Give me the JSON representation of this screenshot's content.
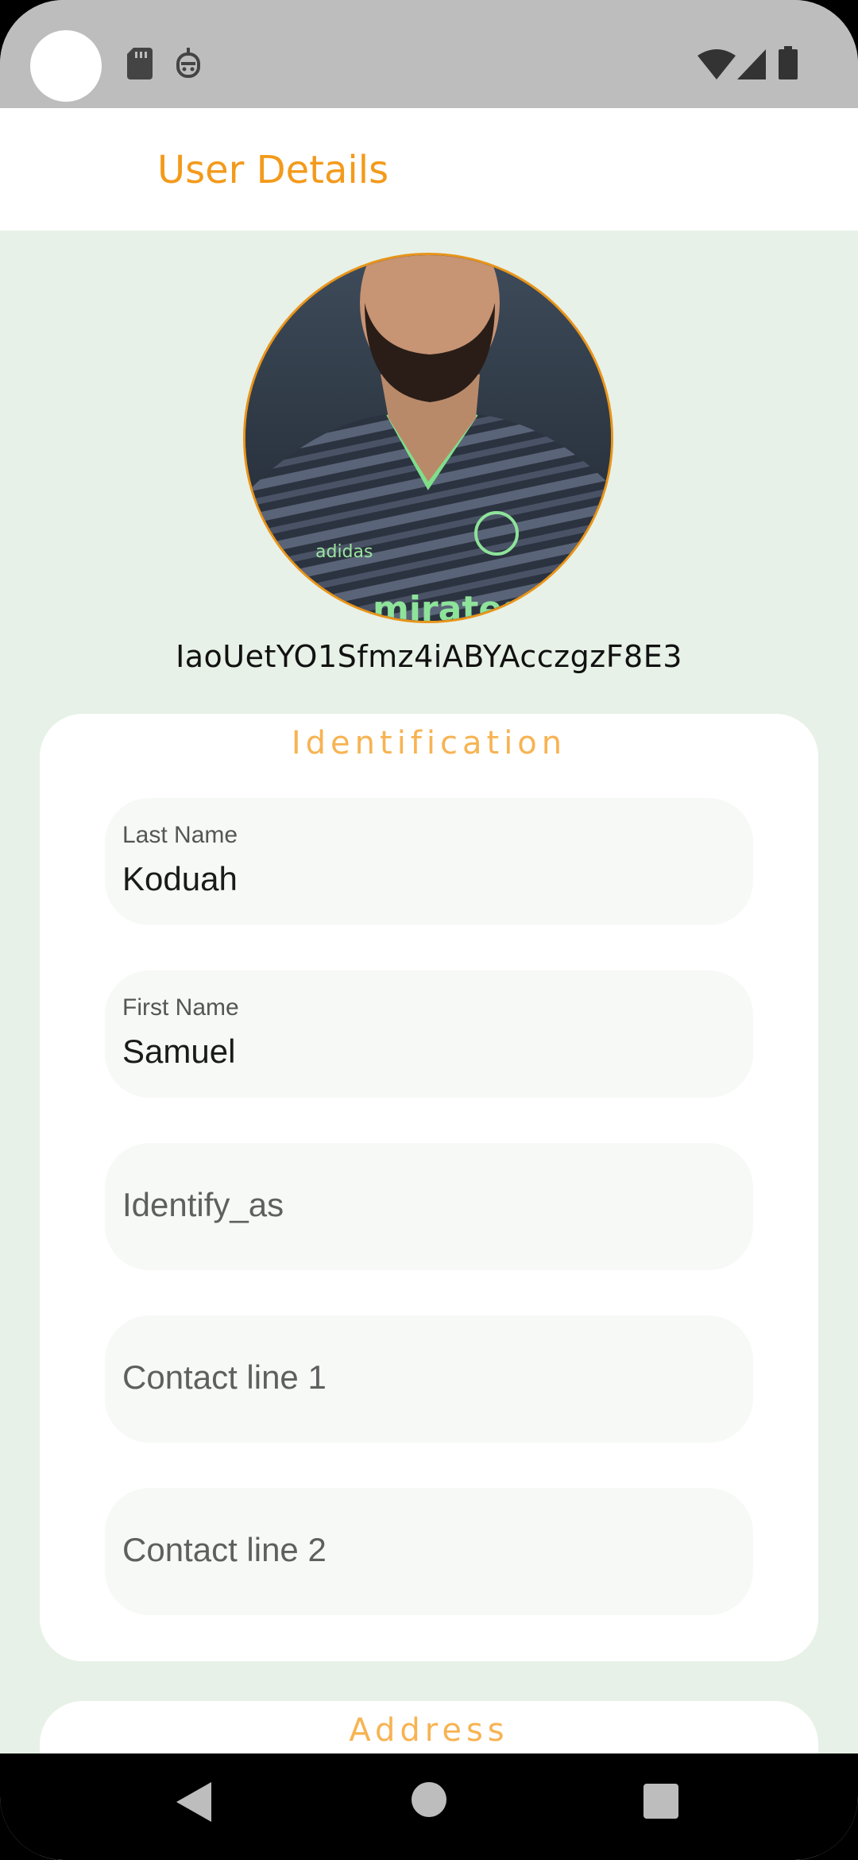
{
  "app_bar": {
    "title": "User Details"
  },
  "profile": {
    "user_id": "IaoUetYO1Sfmz4iABYAcczgzF8E3"
  },
  "identification": {
    "title": "Identification",
    "fields": [
      {
        "label": "Last Name",
        "value": "Koduah"
      },
      {
        "label": "First Name",
        "value": "Samuel"
      },
      {
        "placeholder": "Identify_as"
      },
      {
        "placeholder": "Contact line 1"
      },
      {
        "placeholder": "Contact line 2"
      }
    ]
  },
  "address": {
    "title": "Address"
  },
  "colors": {
    "accent": "#f39a1b",
    "section_title": "#f7b352",
    "background": "#e7f1e7",
    "field_bg": "#f6f9f5"
  },
  "icons": {
    "status_bar": [
      "sdcard-icon",
      "robot-icon",
      "wifi-icon",
      "signal-icon",
      "battery-icon"
    ],
    "nav": [
      "back-icon",
      "home-icon",
      "recents-icon"
    ]
  }
}
